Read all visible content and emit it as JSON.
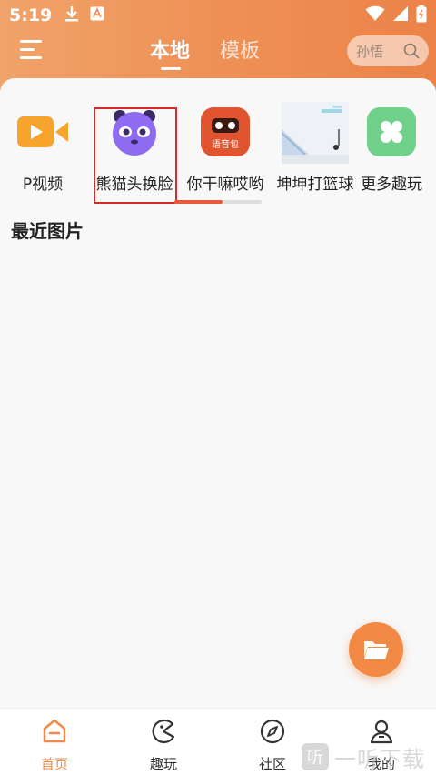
{
  "status": {
    "time": "5:19"
  },
  "topnav": {
    "tabs": [
      {
        "label": "本地"
      },
      {
        "label": "模板"
      }
    ],
    "search": {
      "text": "孙悟"
    }
  },
  "tools": [
    {
      "label": "P视频",
      "icon": "video-camera-icon"
    },
    {
      "label": "熊猫头换脸",
      "icon": "panda-face-icon"
    },
    {
      "label": "你干嘛哎哟",
      "icon": "voice-pack-icon",
      "badge": "语音包"
    },
    {
      "label": "坤坤打篮球",
      "icon": "basketball-game-icon"
    },
    {
      "label": "更多趣玩",
      "icon": "clover-icon"
    }
  ],
  "scroll_progress": 0.55,
  "section": {
    "title": "最近图片"
  },
  "bottomnav": [
    {
      "label": "首页",
      "icon": "home-icon",
      "active": true
    },
    {
      "label": "趣玩",
      "icon": "pacman-icon"
    },
    {
      "label": "社区",
      "icon": "compass-icon"
    },
    {
      "label": "我的",
      "icon": "user-icon"
    }
  ],
  "watermark": {
    "badge": "听",
    "text": "一听下载"
  },
  "colors": {
    "accent": "#ef8a4a",
    "highlight": "#d42b2b"
  }
}
